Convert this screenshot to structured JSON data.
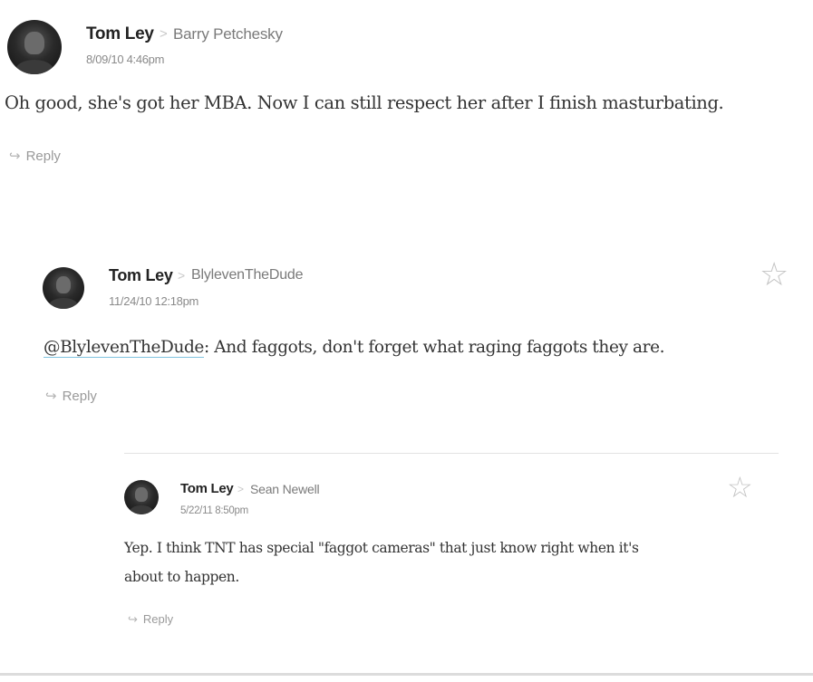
{
  "comments": [
    {
      "author": "Tom Ley",
      "separator": ">",
      "reply_to": "Barry Petchesky",
      "date": "8/09/10 4:46pm",
      "text": "Oh good, she's got her MBA. Now I can still respect her after I finish masturbating.",
      "reply_label": "Reply",
      "reply_arrow": "↪"
    },
    {
      "author": "Tom Ley",
      "separator": ">",
      "reply_to": "BlylevenTheDude",
      "date": "11/24/10 12:18pm",
      "mention": "@BlylevenTheDude",
      "text": ": And faggots, don't forget what raging faggots they are.",
      "reply_label": "Reply",
      "reply_arrow": "↪",
      "star": "☆"
    },
    {
      "author": "Tom Ley",
      "separator": ">",
      "reply_to": "Sean Newell",
      "date": "5/22/11 8:50pm",
      "text_line1": "Yep. I think TNT has special \"faggot cameras\" that just know right when it's",
      "text_line2": "about to happen.",
      "reply_label": "Reply",
      "reply_arrow": "↪",
      "star": "☆"
    }
  ]
}
